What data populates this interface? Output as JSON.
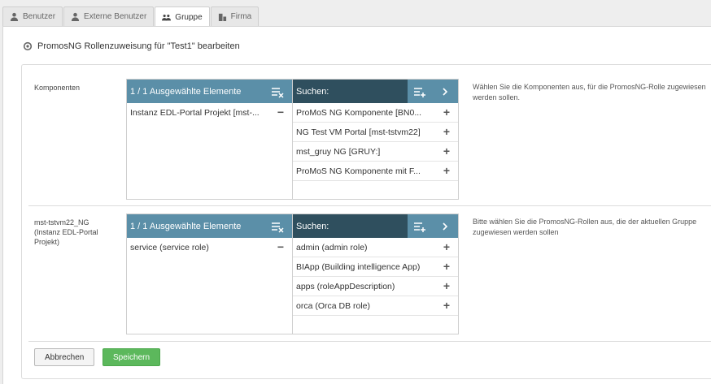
{
  "tabs": [
    {
      "label": "Benutzer",
      "icon": "user-icon",
      "active": false
    },
    {
      "label": "Externe Benutzer",
      "icon": "external-user-icon",
      "active": false
    },
    {
      "label": "Gruppe",
      "icon": "group-icon",
      "active": true
    },
    {
      "label": "Firma",
      "icon": "company-icon",
      "active": false
    }
  ],
  "page_title": "PromosNG Rollenzuweisung für \"Test1\" bearbeiten",
  "sections": [
    {
      "label": "Komponenten",
      "selected_header": "1 / 1 Ausgewählte Elemente",
      "search_header": "Suchen:",
      "selected_items": [
        "Instanz EDL-Portal Projekt [mst-..."
      ],
      "available_items": [
        "ProMoS NG Komponente [BN0...",
        "NG Test VM Portal [mst-tstvm22]",
        "mst_gruy NG [GRUY:]",
        "ProMoS NG Komponente mit F..."
      ],
      "help": "Wählen Sie die Komponenten aus, für die PromosNG-Rolle zugewiesen werden sollen."
    },
    {
      "label": "mst-tstvm22_NG (Instanz EDL-Portal Projekt)",
      "selected_header": "1 / 1 Ausgewählte Elemente",
      "search_header": "Suchen:",
      "selected_items": [
        "service (service role)"
      ],
      "available_items": [
        "admin (admin role)",
        "BIApp (Building intelligence App)",
        "apps (roleAppDescription)",
        "orca (Orca DB role)"
      ],
      "help": "Bitte wählen Sie die PromosNG-Rollen aus, die der aktuellen Gruppe zugewiesen werden sollen"
    }
  ],
  "buttons": {
    "cancel": "Abbrechen",
    "save": "Speichern"
  },
  "colors": {
    "selected_header": "#5b8fa8",
    "search_header": "#2f4f5e",
    "save": "#5cb85c"
  }
}
